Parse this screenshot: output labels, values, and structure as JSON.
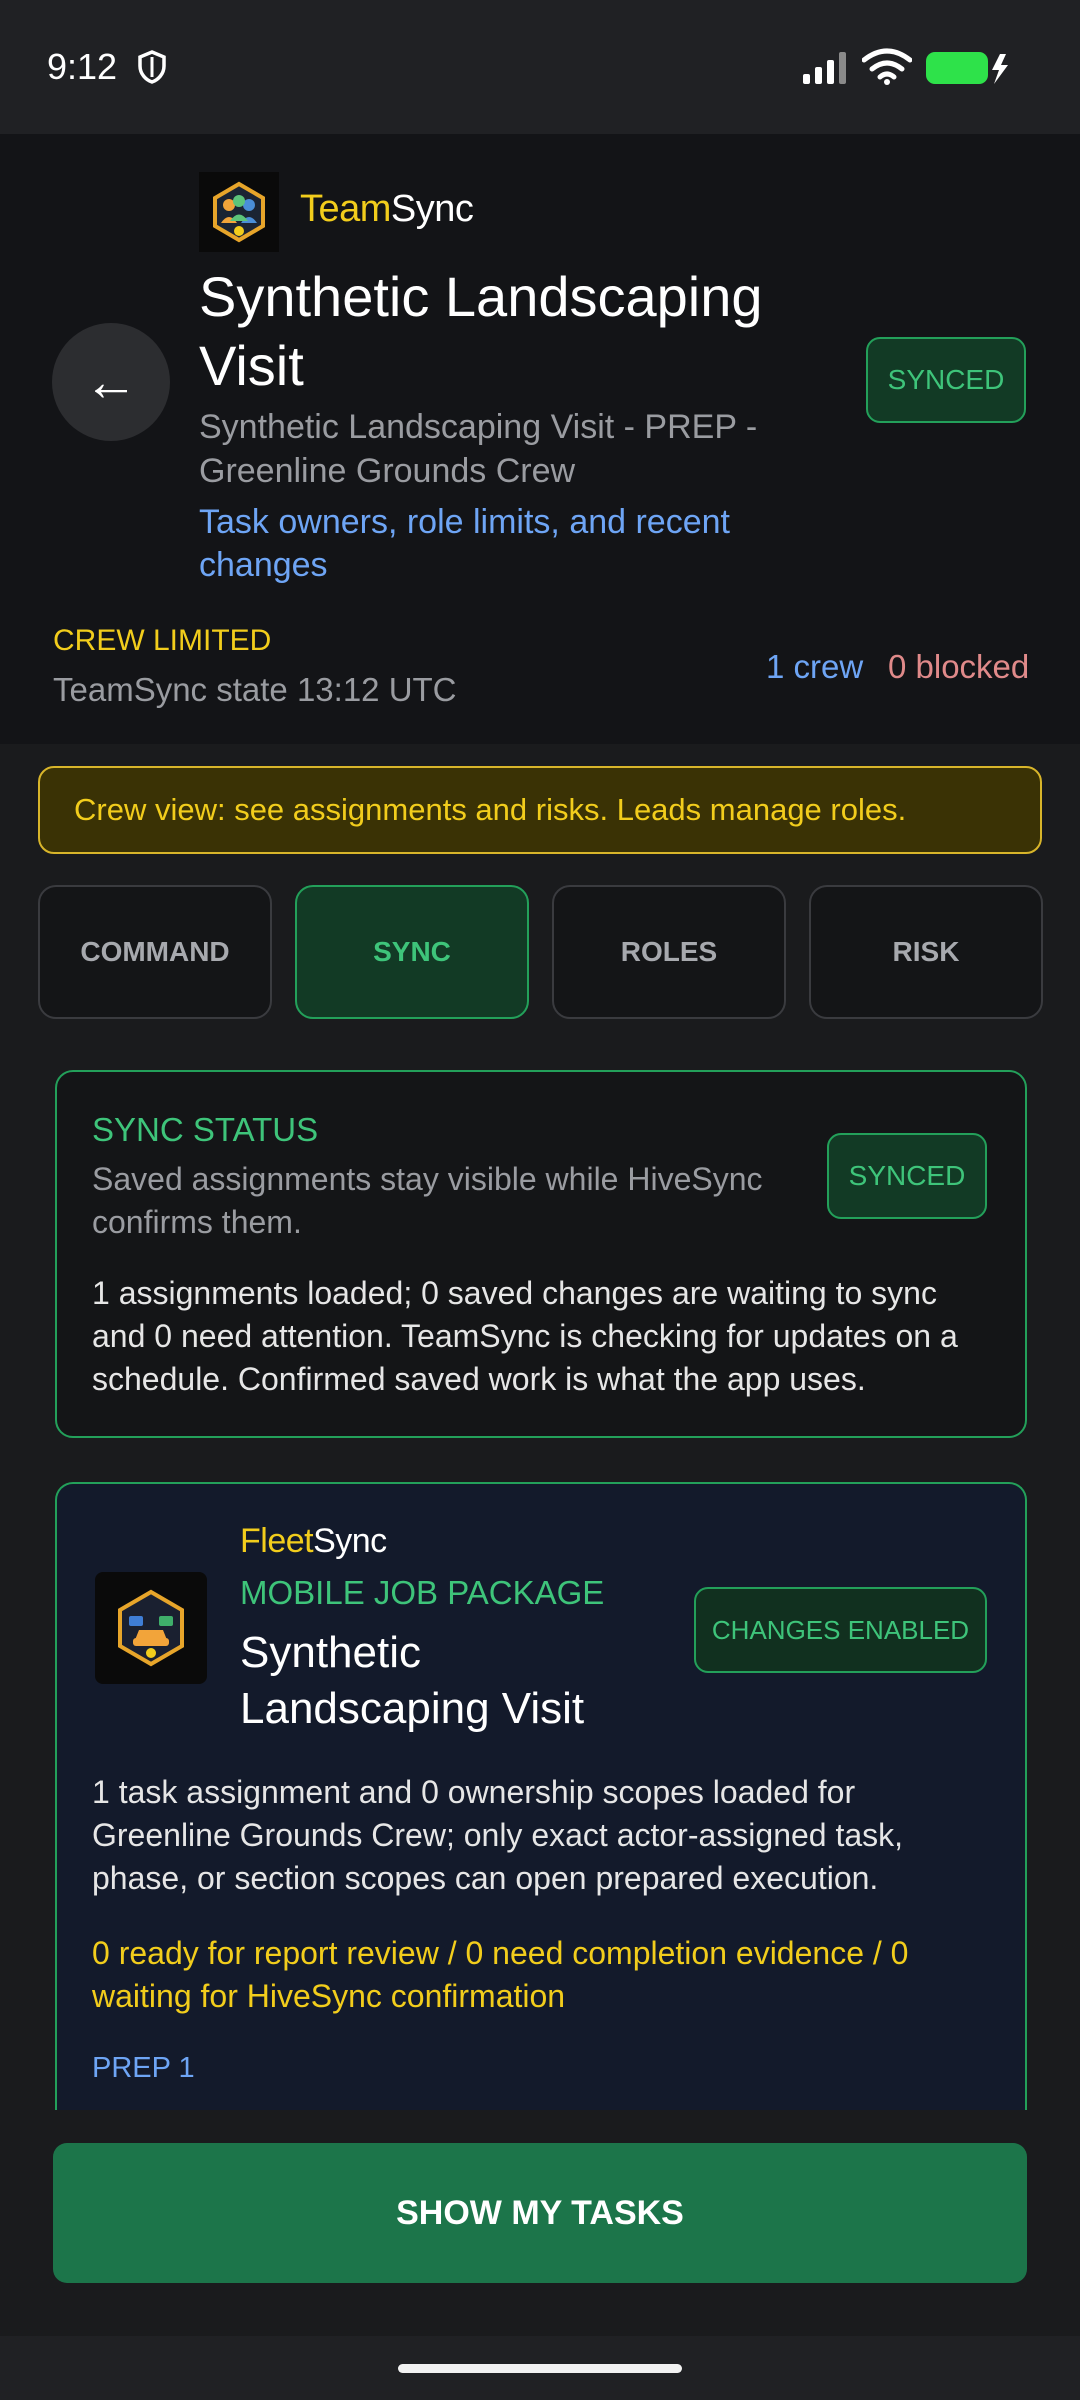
{
  "status_bar": {
    "time": "9:12"
  },
  "header": {
    "brand_part1": "Team",
    "brand_part2": "Sync",
    "title": "Synthetic Landscaping Visit",
    "subtitle": "Synthetic Landscaping Visit - PREP - Greenline Grounds Crew",
    "link": "Task owners, role limits, and recent changes",
    "sync_badge": "SYNCED",
    "access_label": "CREW LIMITED",
    "state_time": "TeamSync state 13:12 UTC",
    "crew_count": "1 crew",
    "blocked_count": "0 blocked"
  },
  "notice": "Crew view: see assignments and risks. Leads manage roles.",
  "tabs": [
    {
      "label": "COMMAND",
      "active": false
    },
    {
      "label": "SYNC",
      "active": true
    },
    {
      "label": "ROLES",
      "active": false
    },
    {
      "label": "RISK",
      "active": false
    }
  ],
  "sync_card": {
    "title": "SYNC STATUS",
    "subtitle": "Saved assignments stay visible while HiveSync confirms them.",
    "badge": "SYNCED",
    "body": "1 assignments loaded; 0 saved changes are waiting to sync and 0 need attention. TeamSync is checking for updates on a schedule. Confirmed saved work is what the app uses."
  },
  "package_card": {
    "brand_part1": "Fleet",
    "brand_part2": "Sync",
    "label": "MOBILE JOB PACKAGE",
    "title": "Synthetic Landscaping Visit",
    "badge": "CHANGES ENABLED",
    "body": "1 task assignment and 0 ownership scopes loaded for Greenline Grounds Crew; only exact actor-assigned task, phase, or section scopes can open prepared execution.",
    "warning": "0 ready for report review / 0 need completion evidence / 0 waiting for HiveSync confirmation",
    "section": "PREP 1"
  },
  "cta": "SHOW MY TASKS",
  "colors": {
    "accent_green": "#3ec47a",
    "accent_yellow": "#f2cd1c",
    "accent_blue": "#6ea5f5",
    "accent_red": "#e08a8a",
    "button_green": "#1c754a"
  }
}
